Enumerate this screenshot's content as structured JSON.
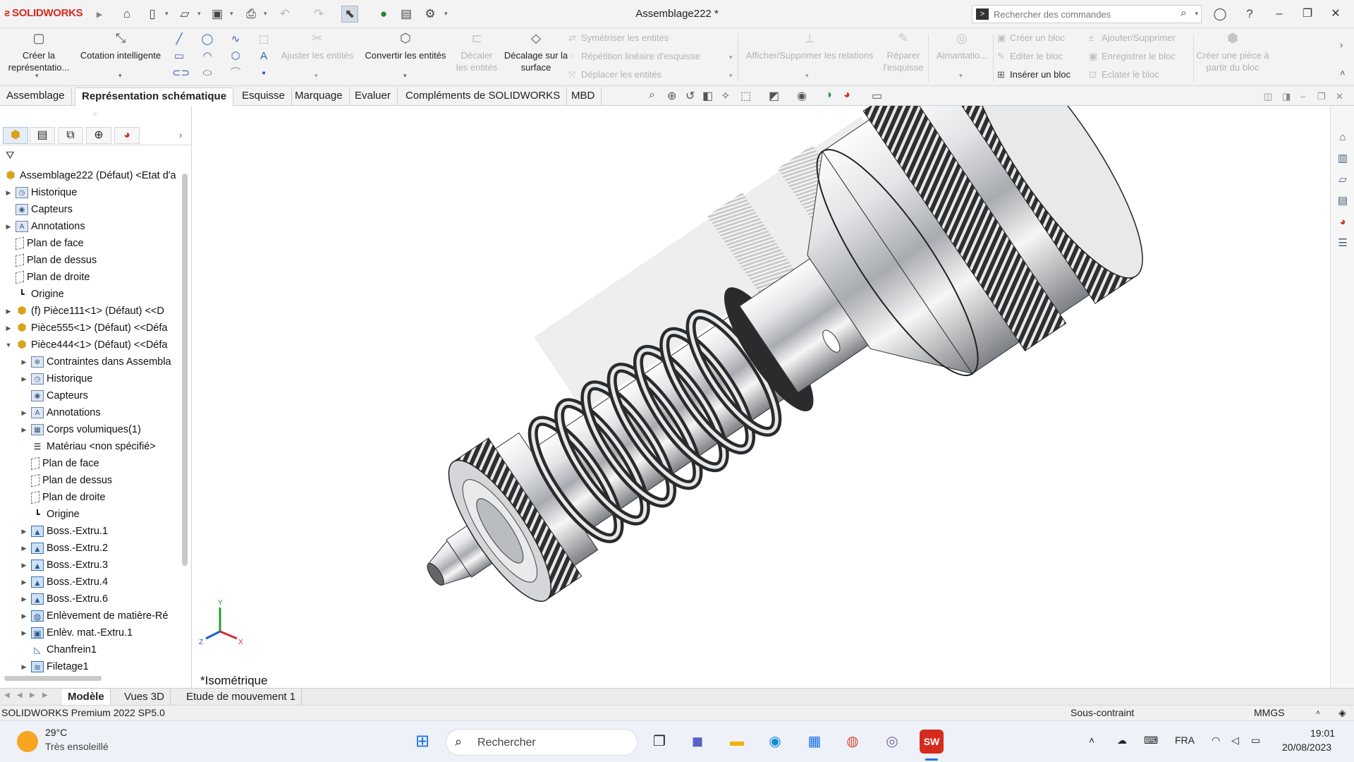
{
  "app": {
    "logo_text": "SOLIDWORKS",
    "window_title": "Assemblage222 *",
    "search_placeholder": "Rechercher des commandes"
  },
  "ribbon": {
    "create_representation": "Créer la représentatio...",
    "smart_dimension": "Cotation intelligente",
    "trim_entities": "Ajuster les entités",
    "convert_entities": "Convertir les entités",
    "offset_entities": "Décaler les entités",
    "offset_on_surface": "Décalage sur la surface",
    "mirror_entities": "Symétriser les entités",
    "linear_pattern": "Répétition linéaire d'esquisse",
    "move_entities": "Déplacer les entités",
    "display_relations": "Afficher/Supprimer les relations",
    "repair_sketch": "Réparer l'esquisse",
    "snapping": "Aimantatio...",
    "create_block": "Créer un bloc",
    "edit_block": "Editer le bloc",
    "insert_block": "Insérer un bloc",
    "add_remove": "Ajouter/Supprimer",
    "save_block": "Enregistrer le bloc",
    "explode_block": "Eclater le bloc",
    "make_part_from_block": "Créer une pièce à partir du bloc"
  },
  "tabs": [
    "Assemblage",
    "Représentation schématique",
    "Esquisse",
    "Marquage",
    "Evaluer",
    "Compléments de SOLIDWORKS",
    "MBD"
  ],
  "active_tab": "Représentation schématique",
  "tree": [
    {
      "label": "Assemblage222 (Défaut) <Etat d'a",
      "icon": "assembly-icon"
    },
    {
      "label": "Historique",
      "icon": "history-folder-icon"
    },
    {
      "label": "Capteurs",
      "icon": "sensor-icon"
    },
    {
      "label": "Annotations",
      "icon": "annotations-icon"
    },
    {
      "label": "Plan de face",
      "icon": "plane-icon"
    },
    {
      "label": "Plan de dessus",
      "icon": "plane-icon"
    },
    {
      "label": "Plan de droite",
      "icon": "plane-icon"
    },
    {
      "label": "Origine",
      "icon": "origin-icon"
    },
    {
      "label": "(f) Pièce111<1> (Défaut) <<D",
      "icon": "part-icon"
    },
    {
      "label": "Pièce555<1> (Défaut) <<Défa",
      "icon": "part-icon"
    },
    {
      "label": "Pièce444<1> (Défaut) <<Défa",
      "icon": "part-icon"
    },
    {
      "label": "Contraintes dans Assembla",
      "icon": "mates-folder-icon"
    },
    {
      "label": "Historique",
      "icon": "history-folder-icon"
    },
    {
      "label": "Capteurs",
      "icon": "sensor-icon"
    },
    {
      "label": "Annotations",
      "icon": "annotations-icon"
    },
    {
      "label": "Corps volumiques(1)",
      "icon": "solid-bodies-icon"
    },
    {
      "label": "Matériau <non spécifié>",
      "icon": "material-icon"
    },
    {
      "label": "Plan de face",
      "icon": "plane-icon"
    },
    {
      "label": "Plan de dessus",
      "icon": "plane-icon"
    },
    {
      "label": "Plan de droite",
      "icon": "plane-icon"
    },
    {
      "label": "Origine",
      "icon": "origin-icon"
    },
    {
      "label": "Boss.-Extru.1",
      "icon": "extrude-icon"
    },
    {
      "label": "Boss.-Extru.2",
      "icon": "extrude-icon"
    },
    {
      "label": "Boss.-Extru.3",
      "icon": "extrude-icon"
    },
    {
      "label": "Boss.-Extru.4",
      "icon": "extrude-icon"
    },
    {
      "label": "Boss.-Extru.6",
      "icon": "extrude-icon"
    },
    {
      "label": "Enlèvement de matière-Ré",
      "icon": "revolve-cut-icon"
    },
    {
      "label": "Enlèv. mat.-Extru.1",
      "icon": "extrude-cut-icon"
    },
    {
      "label": "Chanfrein1",
      "icon": "chamfer-icon"
    },
    {
      "label": "Filetage1",
      "icon": "thread-icon"
    }
  ],
  "viewport": {
    "view_label": "*Isométrique",
    "axis_x": "X",
    "axis_y": "Y",
    "axis_z": "Z"
  },
  "bottom_tabs": [
    "Modèle",
    "Vues 3D",
    "Etude de mouvement 1"
  ],
  "status": {
    "version": "SOLIDWORKS Premium 2022 SP5.0",
    "constraint": "Sous-contraint",
    "units": "MMGS"
  },
  "taskbar": {
    "weather_temp": "29°C",
    "weather_desc": "Très ensoleillé",
    "search": "Rechercher",
    "lang": "FRA",
    "time": "19:01",
    "date": "20/08/2023"
  }
}
